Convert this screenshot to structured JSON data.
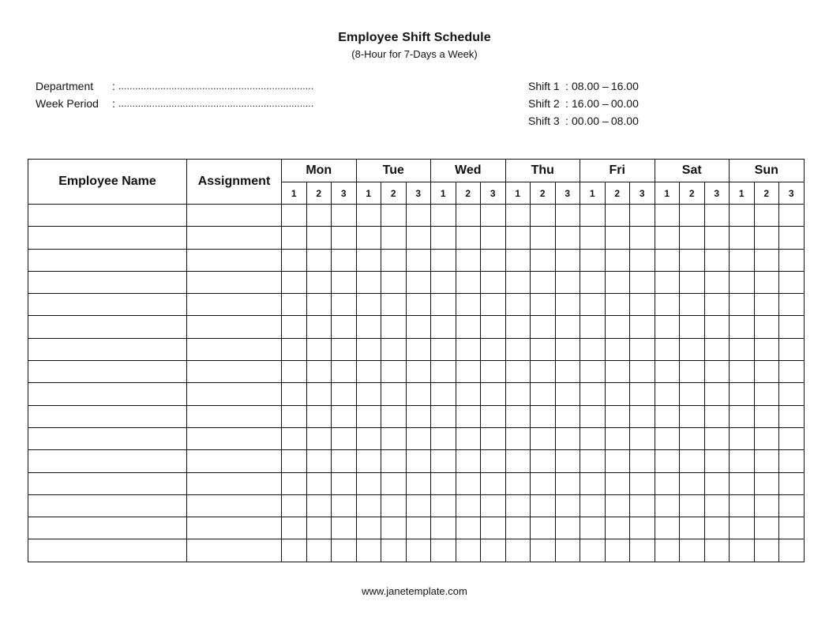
{
  "header": {
    "title": "Employee Shift Schedule",
    "subtitle": "(8-Hour for 7-Days a Week)"
  },
  "info_fields": [
    {
      "label": "Department",
      "colon": ":",
      "value": "......................................................................"
    },
    {
      "label": "Week Period",
      "colon": ":",
      "value": "......................................................................"
    }
  ],
  "shifts": [
    {
      "label": "Shift 1",
      "colon": ":",
      "start": "08.00",
      "dash": "–",
      "end": "16.00"
    },
    {
      "label": "Shift 2",
      "colon": ":",
      "start": "16.00",
      "dash": "–",
      "end": "00.00"
    },
    {
      "label": "Shift 3",
      "colon": ":",
      "start": "00.00",
      "dash": "–",
      "end": "08.00"
    }
  ],
  "table": {
    "col_employee": "Employee Name",
    "col_assignment": "Assignment",
    "days": [
      "Mon",
      "Tue",
      "Wed",
      "Thu",
      "Fri",
      "Sat",
      "Sun"
    ],
    "shift_numbers": [
      "1",
      "2",
      "3"
    ],
    "row_count": 16
  },
  "footer": {
    "website": "www.janetemplate.com"
  }
}
